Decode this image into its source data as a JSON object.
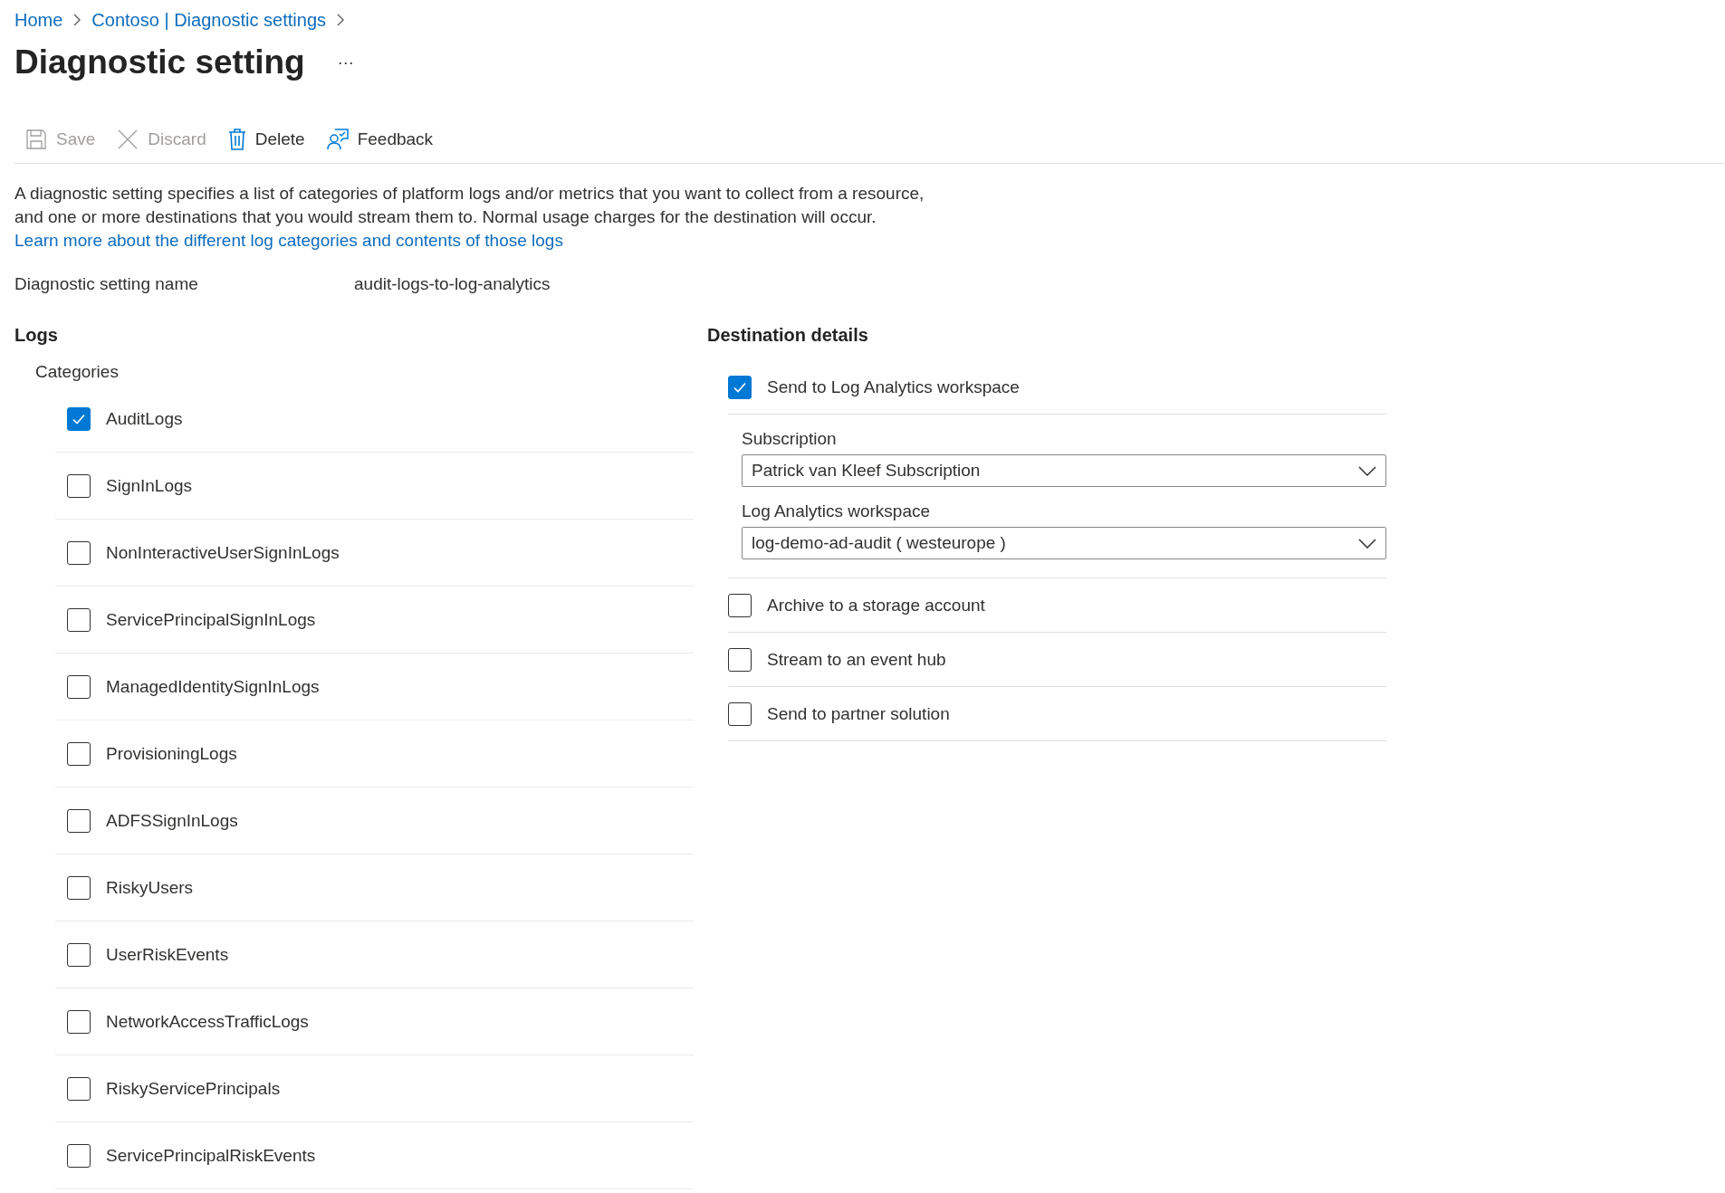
{
  "breadcrumb": [
    {
      "label": "Home"
    },
    {
      "label": "Contoso | Diagnostic settings"
    }
  ],
  "title": "Diagnostic setting",
  "more_button": "···",
  "toolbar": [
    {
      "kind": "save",
      "label": "Save",
      "disabled": true
    },
    {
      "kind": "discard",
      "label": "Discard",
      "disabled": true
    },
    {
      "kind": "delete",
      "label": "Delete",
      "disabled": false
    },
    {
      "kind": "feedback",
      "label": "Feedback",
      "disabled": false
    }
  ],
  "description": {
    "text": "A diagnostic setting specifies a list of categories of platform logs and/or metrics that you want to collect from a resource, and one or more destinations that you would stream them to. Normal usage charges for the destination will occur. ",
    "link": "Learn more about the different log categories and contents of those logs"
  },
  "setting_name": {
    "label": "Diagnostic setting name",
    "value": "audit-logs-to-log-analytics"
  },
  "logs": {
    "heading": "Logs",
    "subheading": "Categories",
    "categories": [
      {
        "label": "AuditLogs",
        "checked": true
      },
      {
        "label": "SignInLogs",
        "checked": false
      },
      {
        "label": "NonInteractiveUserSignInLogs",
        "checked": false
      },
      {
        "label": "ServicePrincipalSignInLogs",
        "checked": false
      },
      {
        "label": "ManagedIdentitySignInLogs",
        "checked": false
      },
      {
        "label": "ProvisioningLogs",
        "checked": false
      },
      {
        "label": "ADFSSignInLogs",
        "checked": false
      },
      {
        "label": "RiskyUsers",
        "checked": false
      },
      {
        "label": "UserRiskEvents",
        "checked": false
      },
      {
        "label": "NetworkAccessTrafficLogs",
        "checked": false
      },
      {
        "label": "RiskyServicePrincipals",
        "checked": false
      },
      {
        "label": "ServicePrincipalRiskEvents",
        "checked": false
      }
    ]
  },
  "destination": {
    "heading": "Destination details",
    "options": [
      {
        "label": "Send to Log Analytics workspace",
        "checked": true,
        "fields": [
          {
            "label": "Subscription",
            "value": "Patrick van Kleef Subscription"
          },
          {
            "label": "Log Analytics workspace",
            "value": "log-demo-ad-audit ( westeurope )"
          }
        ]
      },
      {
        "label": "Archive to a storage account",
        "checked": false
      },
      {
        "label": "Stream to an event hub",
        "checked": false
      },
      {
        "label": "Send to partner solution",
        "checked": false
      }
    ]
  }
}
